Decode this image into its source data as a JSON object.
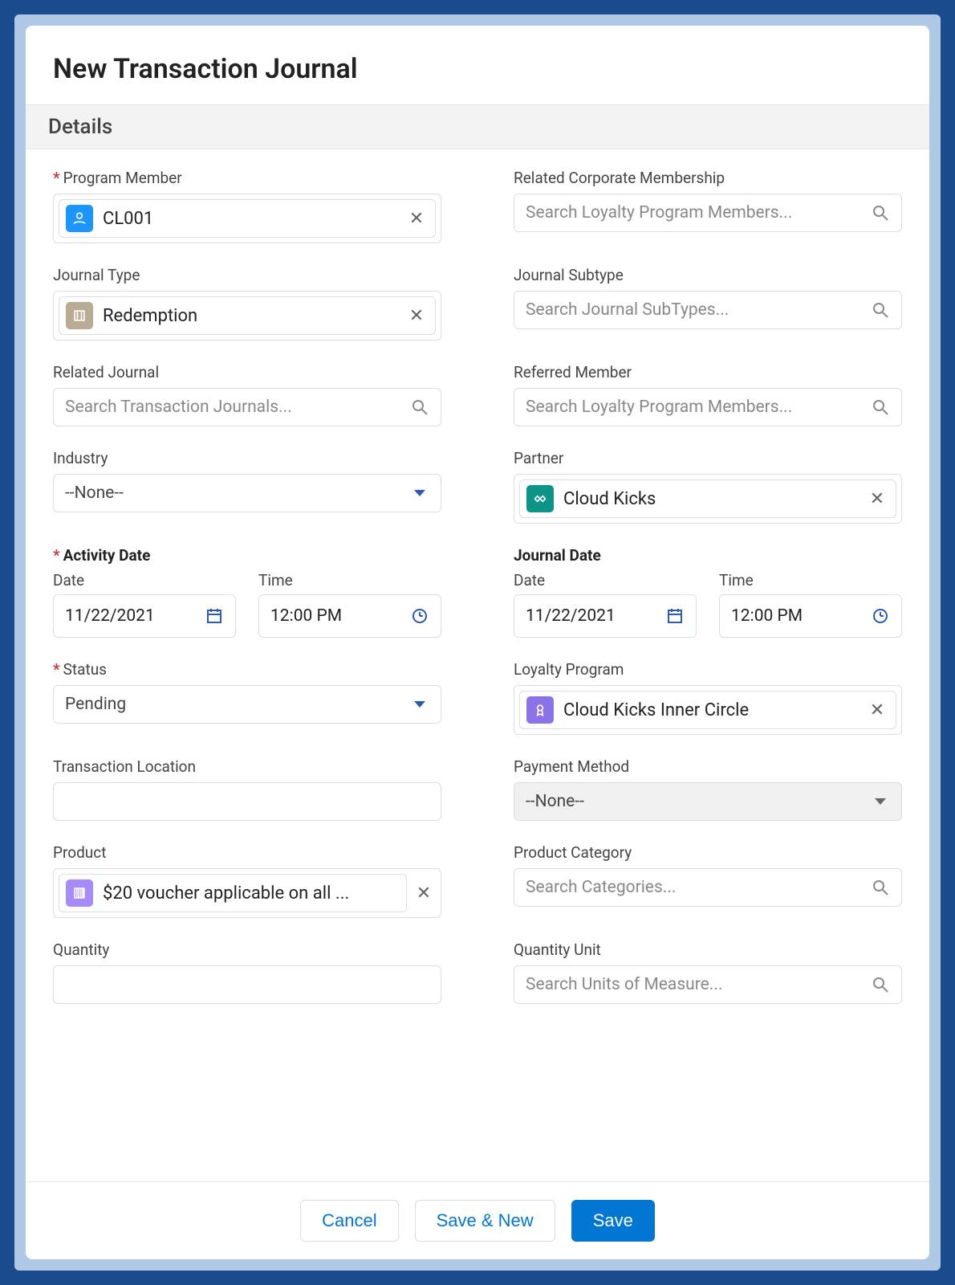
{
  "title": "New Transaction Journal",
  "section": "Details",
  "fields": {
    "programMember": {
      "label": "Program Member",
      "value": "CL001"
    },
    "relatedCorpMembership": {
      "label": "Related Corporate Membership",
      "placeholder": "Search Loyalty Program Members..."
    },
    "journalType": {
      "label": "Journal Type",
      "value": "Redemption"
    },
    "journalSubtype": {
      "label": "Journal Subtype",
      "placeholder": "Search Journal SubTypes..."
    },
    "relatedJournal": {
      "label": "Related Journal",
      "placeholder": "Search Transaction Journals..."
    },
    "referredMember": {
      "label": "Referred Member",
      "placeholder": "Search Loyalty Program Members..."
    },
    "industry": {
      "label": "Industry",
      "value": "--None--"
    },
    "partner": {
      "label": "Partner",
      "value": "Cloud Kicks"
    },
    "activityDate": {
      "label": "Activity Date",
      "dateLabel": "Date",
      "timeLabel": "Time",
      "date": "11/22/2021",
      "time": "12:00 PM"
    },
    "journalDate": {
      "label": "Journal Date",
      "dateLabel": "Date",
      "timeLabel": "Time",
      "date": "11/22/2021",
      "time": "12:00 PM"
    },
    "status": {
      "label": "Status",
      "value": "Pending"
    },
    "loyaltyProgram": {
      "label": "Loyalty Program",
      "value": "Cloud Kicks Inner Circle"
    },
    "transactionLocation": {
      "label": "Transaction Location",
      "value": ""
    },
    "paymentMethod": {
      "label": "Payment Method",
      "value": "--None--"
    },
    "product": {
      "label": "Product",
      "value": "$20 voucher applicable on all ..."
    },
    "productCategory": {
      "label": "Product Category",
      "placeholder": "Search Categories..."
    },
    "quantity": {
      "label": "Quantity",
      "value": ""
    },
    "quantityUnit": {
      "label": "Quantity Unit",
      "placeholder": "Search Units of Measure..."
    }
  },
  "buttons": {
    "cancel": "Cancel",
    "saveNew": "Save & New",
    "save": "Save"
  }
}
